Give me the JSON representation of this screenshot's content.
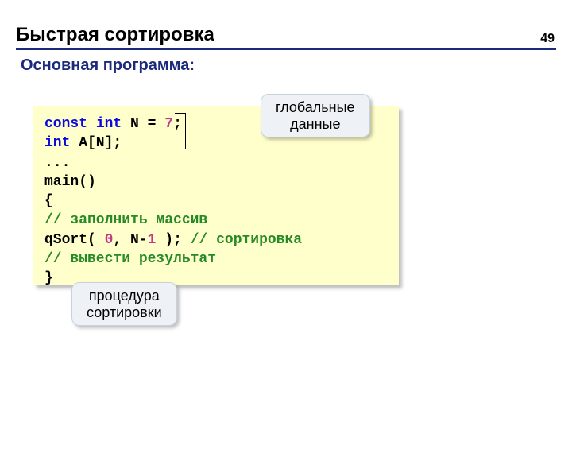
{
  "page_number": "49",
  "title": "Быстрая сортировка",
  "subtitle": "Основная программа:",
  "code": {
    "l1_kw1": "const",
    "l1_kw2": "int",
    "l1_txt1": " N ",
    "l1_eq": "=",
    "l1_num": " 7",
    "l1_semi": ";",
    "l2_kw": "int",
    "l2_txt": " A[N];",
    "l3": "...",
    "l4": "main()",
    "l5": "{",
    "l6_ind": "  ",
    "l6_cmt": "// заполнить массив",
    "l7_ind": "  ",
    "l7_txt1": "qSort( ",
    "l7_num1": "0",
    "l7_txt2": ", N-",
    "l7_num2": "1",
    "l7_txt3": " ); ",
    "l7_cmt": "// сортировка",
    "l8_ind": "  ",
    "l8_cmt": "// вывести результат",
    "l9": "}"
  },
  "callout_top_l1": "глобальные",
  "callout_top_l2": "данные",
  "callout_bottom_l1": "процедура",
  "callout_bottom_l2": "сортировки"
}
